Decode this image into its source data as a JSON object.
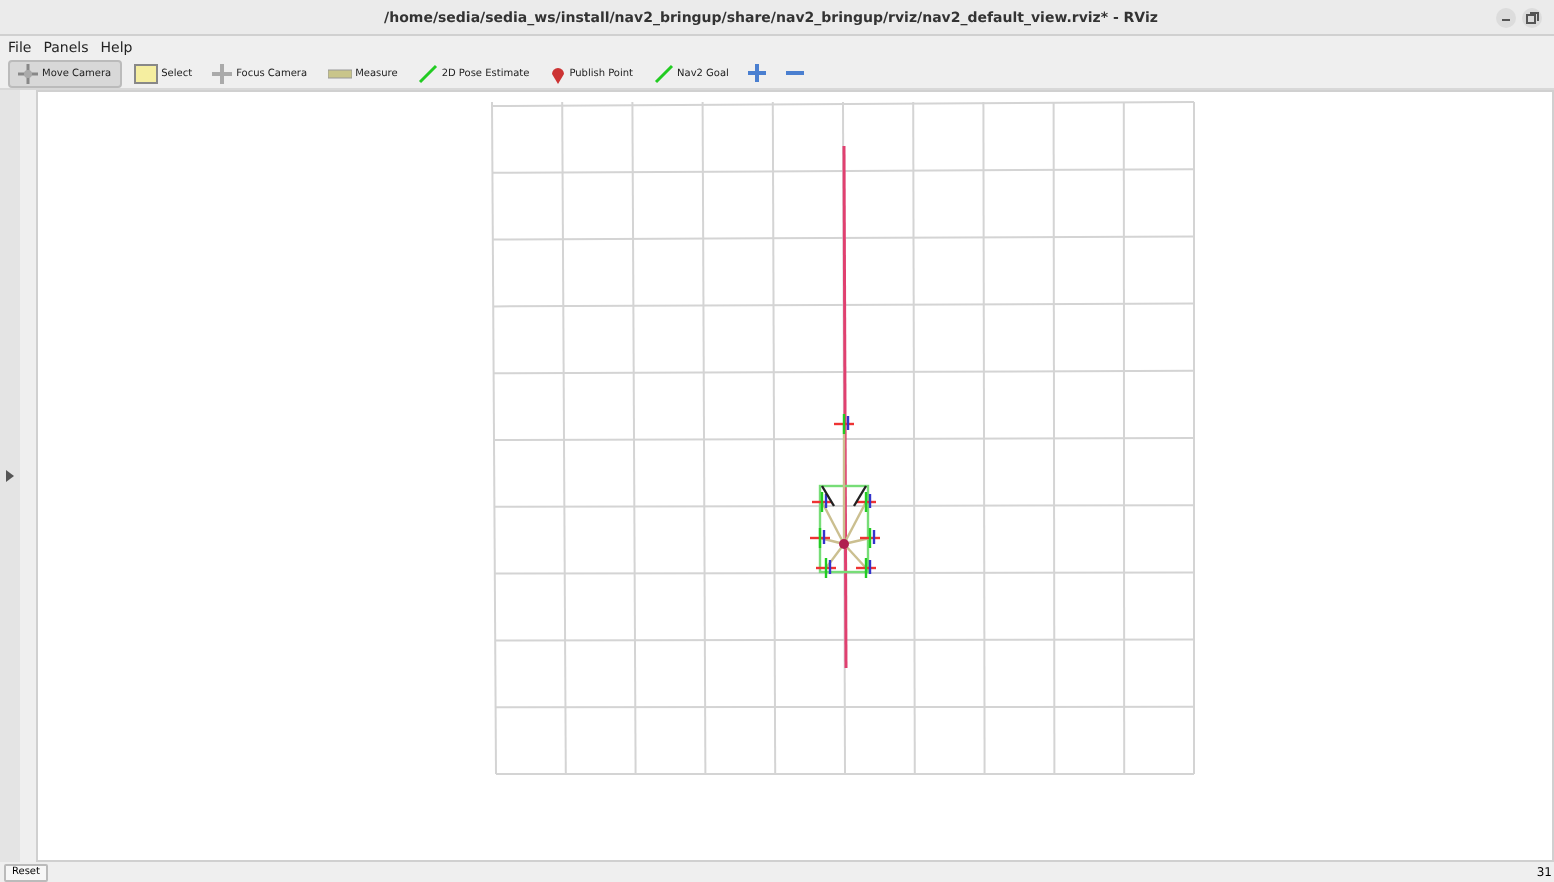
{
  "window": {
    "title": "/home/sedia/sedia_ws/install/nav2_bringup/share/nav2_bringup/rviz/nav2_default_view.rviz* - RViz"
  },
  "menu": [
    {
      "label": "File"
    },
    {
      "label": "Panels"
    },
    {
      "label": "Help"
    }
  ],
  "toolbar": [
    {
      "kind": "move",
      "label": "Move Camera",
      "selected": true
    },
    {
      "kind": "select",
      "label": "Select",
      "selected": false
    },
    {
      "kind": "focus",
      "label": "Focus Camera",
      "selected": false
    },
    {
      "kind": "measure",
      "label": "Measure",
      "selected": false
    },
    {
      "kind": "pose",
      "label": "2D Pose Estimate",
      "selected": false
    },
    {
      "kind": "point",
      "label": "Publish Point",
      "selected": false
    },
    {
      "kind": "goal",
      "label": "Nav2 Goal",
      "selected": false
    },
    {
      "kind": "add"
    },
    {
      "kind": "remove"
    }
  ],
  "status_bar": {
    "button": "Reset",
    "fps": "31"
  }
}
